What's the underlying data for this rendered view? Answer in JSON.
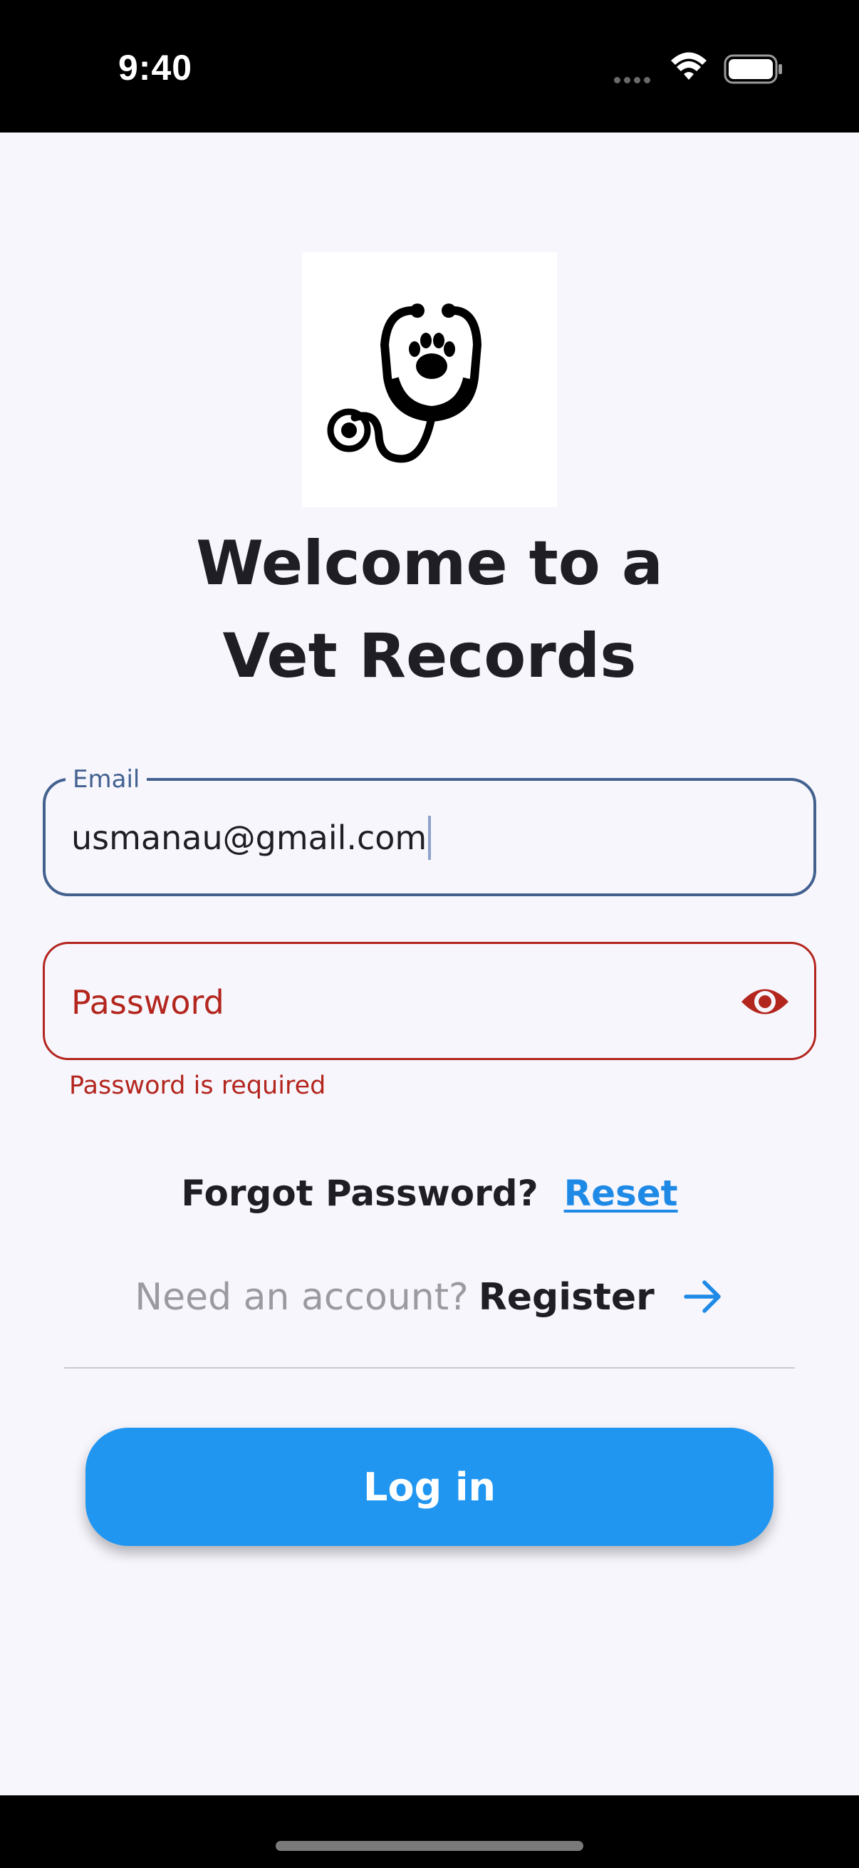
{
  "status_bar": {
    "time": "9:40"
  },
  "welcome": {
    "line1": "Welcome to a",
    "line2": "Vet Records"
  },
  "email": {
    "label": "Email",
    "value": "usmanau@gmail.com"
  },
  "password": {
    "placeholder": "Password",
    "error": "Password is required"
  },
  "forgot": {
    "text": "Forgot Password?",
    "link": "Reset"
  },
  "register": {
    "prompt": "Need an account?",
    "link": "Register"
  },
  "login_button": {
    "label": "Log in"
  },
  "icons": {
    "logo": "stethoscope-paw-icon",
    "password_toggle": "eye-icon",
    "register_arrow": "arrow-right-icon"
  },
  "colors": {
    "primary": "#2196f0",
    "focus_border": "#42618f",
    "error": "#b3261e",
    "link": "#1f8ae6",
    "background": "#f7f6fd"
  }
}
